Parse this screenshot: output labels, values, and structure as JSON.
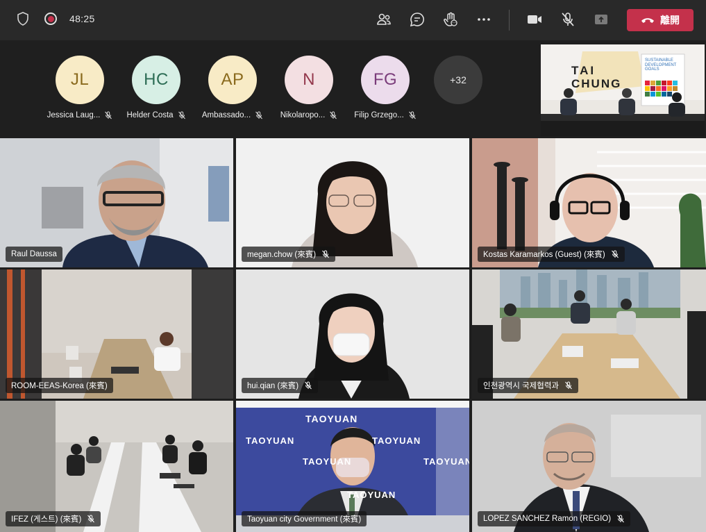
{
  "topbar": {
    "timer": "48:25",
    "leave_label": "離開",
    "icons": [
      "shield-icon",
      "recording-icon",
      "people-icon",
      "chat-icon",
      "raise-hand-icon",
      "more-icon",
      "camera-icon",
      "mic-off-icon",
      "share-icon",
      "phone-hangup-icon"
    ]
  },
  "roster": [
    {
      "initials": "JL",
      "name": "Jessica Laug...",
      "color": "#f8ebc6",
      "text_color": "#8a6a1d"
    },
    {
      "initials": "HC",
      "name": "Helder Costa",
      "color": "#d7efe5",
      "text_color": "#2d6d55"
    },
    {
      "initials": "AP",
      "name": "Ambassado...",
      "color": "#f8ebc6",
      "text_color": "#8a6a1d"
    },
    {
      "initials": "N",
      "name": "Nikolaropo...",
      "color": "#f3dfe2",
      "text_color": "#93384c"
    },
    {
      "initials": "FG",
      "name": "Filip Grzego...",
      "color": "#ecdcec",
      "text_color": "#7a3c7a"
    }
  ],
  "overflow_count": "+32",
  "pip": {
    "sign_text_1": "TAI",
    "sign_text_2": "CHUNG",
    "sdg_text": "SUSTAINABLE DEVELOPMENT GOALS"
  },
  "tiles": [
    {
      "name": "Raul Daussa",
      "muted": false,
      "active": true
    },
    {
      "name": "megan.chow (來賓)",
      "muted": true
    },
    {
      "name": "Kostas Karamarkos (Guest) (來賓)",
      "muted": true
    },
    {
      "name": "ROOM-EEAS-Korea (來賓)",
      "muted": false
    },
    {
      "name": "hui.qian (來賓)",
      "muted": true
    },
    {
      "name": "인천광역시 국제협력과",
      "muted": true
    },
    {
      "name": "IFEZ (게스트) (來賓)",
      "muted": true
    },
    {
      "name": "Taoyuan city Government (來賓)",
      "muted": false
    },
    {
      "name": "LOPEZ SANCHEZ Ramon (REGIO)",
      "muted": true
    }
  ],
  "taoyuan_banner_text": "TAOYUAN",
  "colors": {
    "accent": "#9ea2ff",
    "leave": "#c4314b",
    "bar": "#292929",
    "stage": "#1f1f1f"
  }
}
